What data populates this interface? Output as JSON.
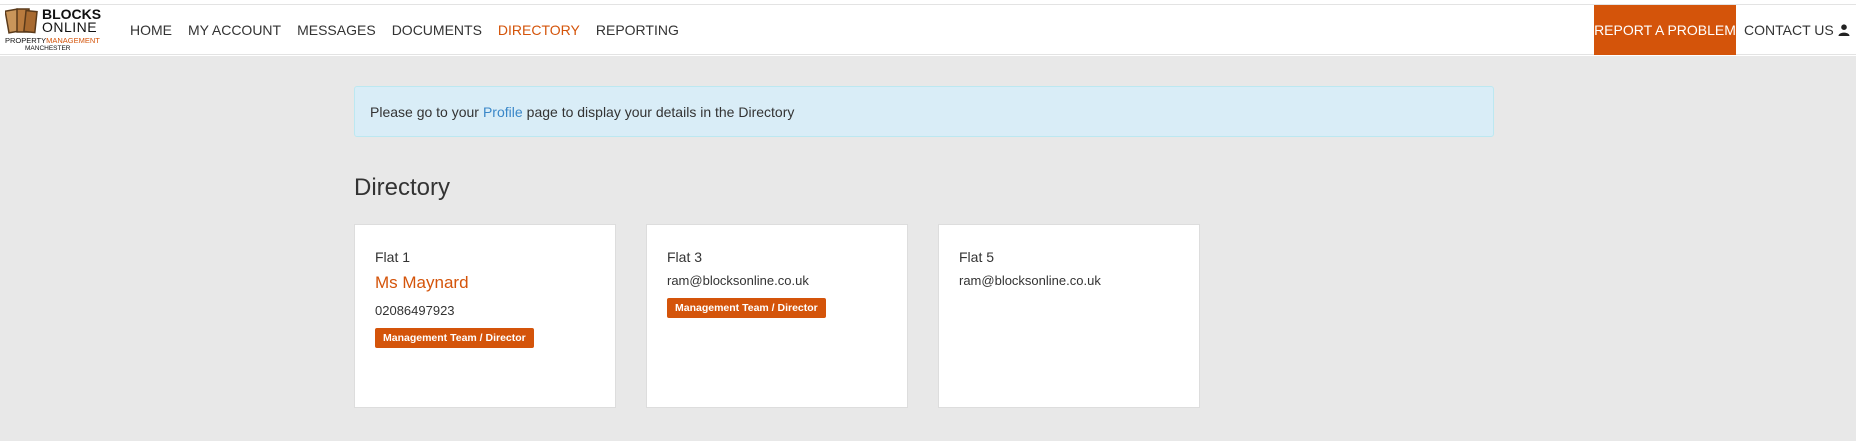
{
  "logo": {
    "line_blocks": "BLOCKS",
    "line_online": "ONLINE",
    "property": "PROPERTY",
    "management": "MANAGEMENT",
    "city": "MANCHESTER"
  },
  "nav": {
    "items": [
      {
        "label": "HOME"
      },
      {
        "label": "MY ACCOUNT"
      },
      {
        "label": "MESSAGES"
      },
      {
        "label": "DOCUMENTS"
      },
      {
        "label": "DIRECTORY"
      },
      {
        "label": "REPORTING"
      }
    ],
    "report_label": "REPORT A PROBLEM",
    "contact_label": "CONTACT US",
    "accent_color": "#d4540a"
  },
  "alert": {
    "prefix": "Please go to your",
    "link": "Profile",
    "suffix": "page to display your details in the Directory"
  },
  "heading": "Directory",
  "cards": [
    {
      "flat": "Flat 1",
      "name": "Ms Maynard",
      "phone": "02086497923",
      "badge": "Management Team / Director"
    },
    {
      "flat": "Flat 3",
      "email": "ram@blocksonline.co.uk",
      "badge": "Management Team / Director"
    },
    {
      "flat": "Flat 5",
      "email": "ram@blocksonline.co.uk"
    }
  ]
}
